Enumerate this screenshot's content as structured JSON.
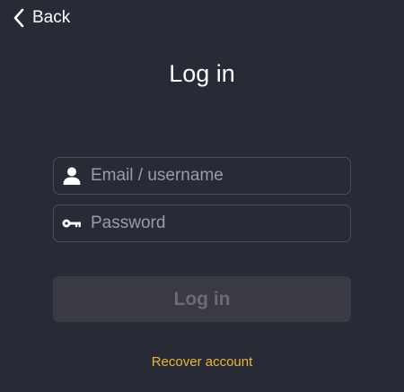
{
  "header": {
    "back_label": "Back",
    "back_icon": "chevron-left-icon"
  },
  "title": "Log in",
  "form": {
    "email": {
      "placeholder": "Email / username",
      "value": "",
      "icon": "user-icon"
    },
    "password": {
      "placeholder": "Password",
      "value": "",
      "icon": "key-icon"
    },
    "submit_label": "Log in"
  },
  "recover_label": "Recover account",
  "colors": {
    "background": "#282a35",
    "field_border": "#4a4d5a",
    "button_disabled_bg": "#393a44",
    "button_disabled_text": "#6b6c74",
    "link": "#e7b83a"
  }
}
